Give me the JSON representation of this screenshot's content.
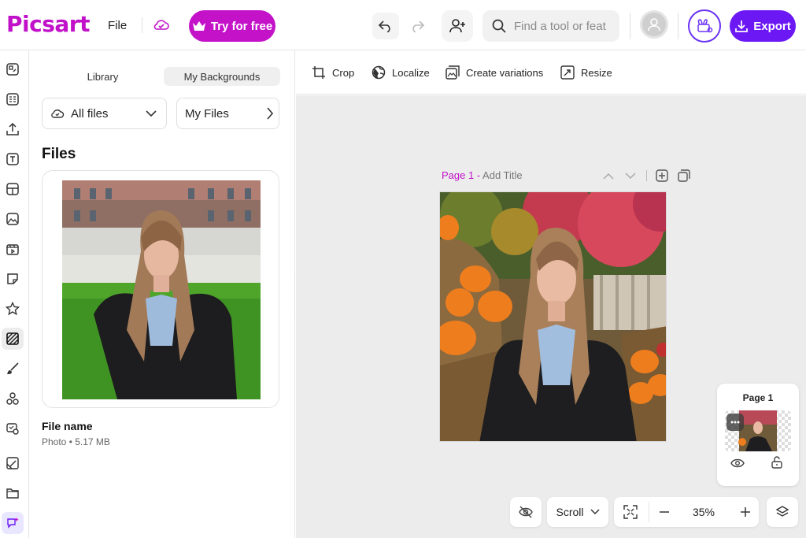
{
  "app": {
    "logo": "Picsart",
    "brand_color": "#c112c9",
    "accent_color": "#6b18f5"
  },
  "header": {
    "file_menu": "File",
    "try_button": "Try for free",
    "search_placeholder": "Find a tool or feat",
    "export_button": "Export"
  },
  "rail": {
    "items": [
      "templates-icon",
      "layouts-icon",
      "upload-icon",
      "text-icon",
      "elements-icon",
      "photos-icon",
      "videos-icon",
      "stickers-icon",
      "favorites-icon",
      "backgrounds-icon",
      "draw-icon",
      "shapes-icon",
      "brand-kit-icon",
      "edit-icon",
      "folder-icon",
      "ai-assistant-icon"
    ],
    "active": "backgrounds-icon"
  },
  "panel": {
    "tabs": [
      "Library",
      "My Backgrounds"
    ],
    "active_tab": "My Backgrounds",
    "filter_all": "All files",
    "filter_my": "My Files",
    "section_title": "Files",
    "file": {
      "name": "File name",
      "meta": "Photo • 5.17 MB"
    }
  },
  "context_toolbar": {
    "items": [
      {
        "label": "Crop",
        "icon": "crop-icon"
      },
      {
        "label": "Localize",
        "icon": "localize-icon"
      },
      {
        "label": "Create variations",
        "icon": "variations-icon"
      },
      {
        "label": "Resize",
        "icon": "resize-icon"
      }
    ]
  },
  "canvas": {
    "page_label": "Page 1",
    "page_separator": " - ",
    "add_title": "Add Title",
    "pages_panel_title": "Page 1",
    "scroll_mode": "Scroll",
    "zoom": "35%"
  }
}
